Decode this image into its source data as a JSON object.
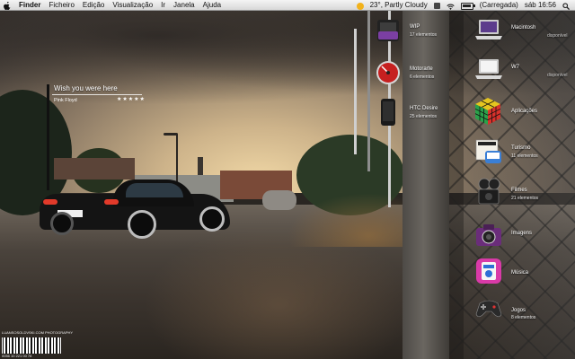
{
  "menubar": {
    "items": [
      "Finder",
      "Ficheiro",
      "Edição",
      "Visualização",
      "Ir",
      "Janela",
      "Ajuda"
    ],
    "weather": "23°, Partly Cloudy",
    "battery": "(Carregada)",
    "clock": "sáb 16:56"
  },
  "widget": {
    "song": "Wish you were here",
    "artist": "Pink Floyd",
    "rating": "★★★★★"
  },
  "stacks_left": [
    {
      "label": "WIP",
      "sub": "17 elementos",
      "icon": "folder-wip-icon"
    },
    {
      "label": "Motorarte",
      "sub": "6 elementos",
      "icon": "gauge-icon"
    },
    {
      "label": "HTC Desire",
      "sub": "25 elementos",
      "icon": "phone-icon"
    }
  ],
  "stacks_right": [
    {
      "label": "Macintosh",
      "sub": "disponível",
      "icon": "macbook-icon"
    },
    {
      "label": "W7",
      "sub": "disponível",
      "icon": "laptop-icon"
    },
    {
      "label": "Aplicações",
      "sub": "",
      "icon": "rubiks-cube-icon"
    },
    {
      "label": "Turismo",
      "sub": "11 elementos",
      "icon": "times-newspaper-icon"
    },
    {
      "label": "Filmes",
      "sub": "21 elementos",
      "icon": "film-camera-icon"
    },
    {
      "label": "Imagens",
      "sub": "",
      "icon": "camera-icon"
    },
    {
      "label": "Música",
      "sub": "",
      "icon": "itunes-icon"
    },
    {
      "label": "Jogos",
      "sub": "8 elementos",
      "icon": "gamepad-icon"
    }
  ],
  "watermark": {
    "top": "LUANSOSOLDVSKI.COM PHOTOGRAPHY",
    "bottom": "0056 10 221 00 78"
  },
  "colors": {
    "menubar": "#e6e6e6",
    "sky": "#cdb38a"
  }
}
